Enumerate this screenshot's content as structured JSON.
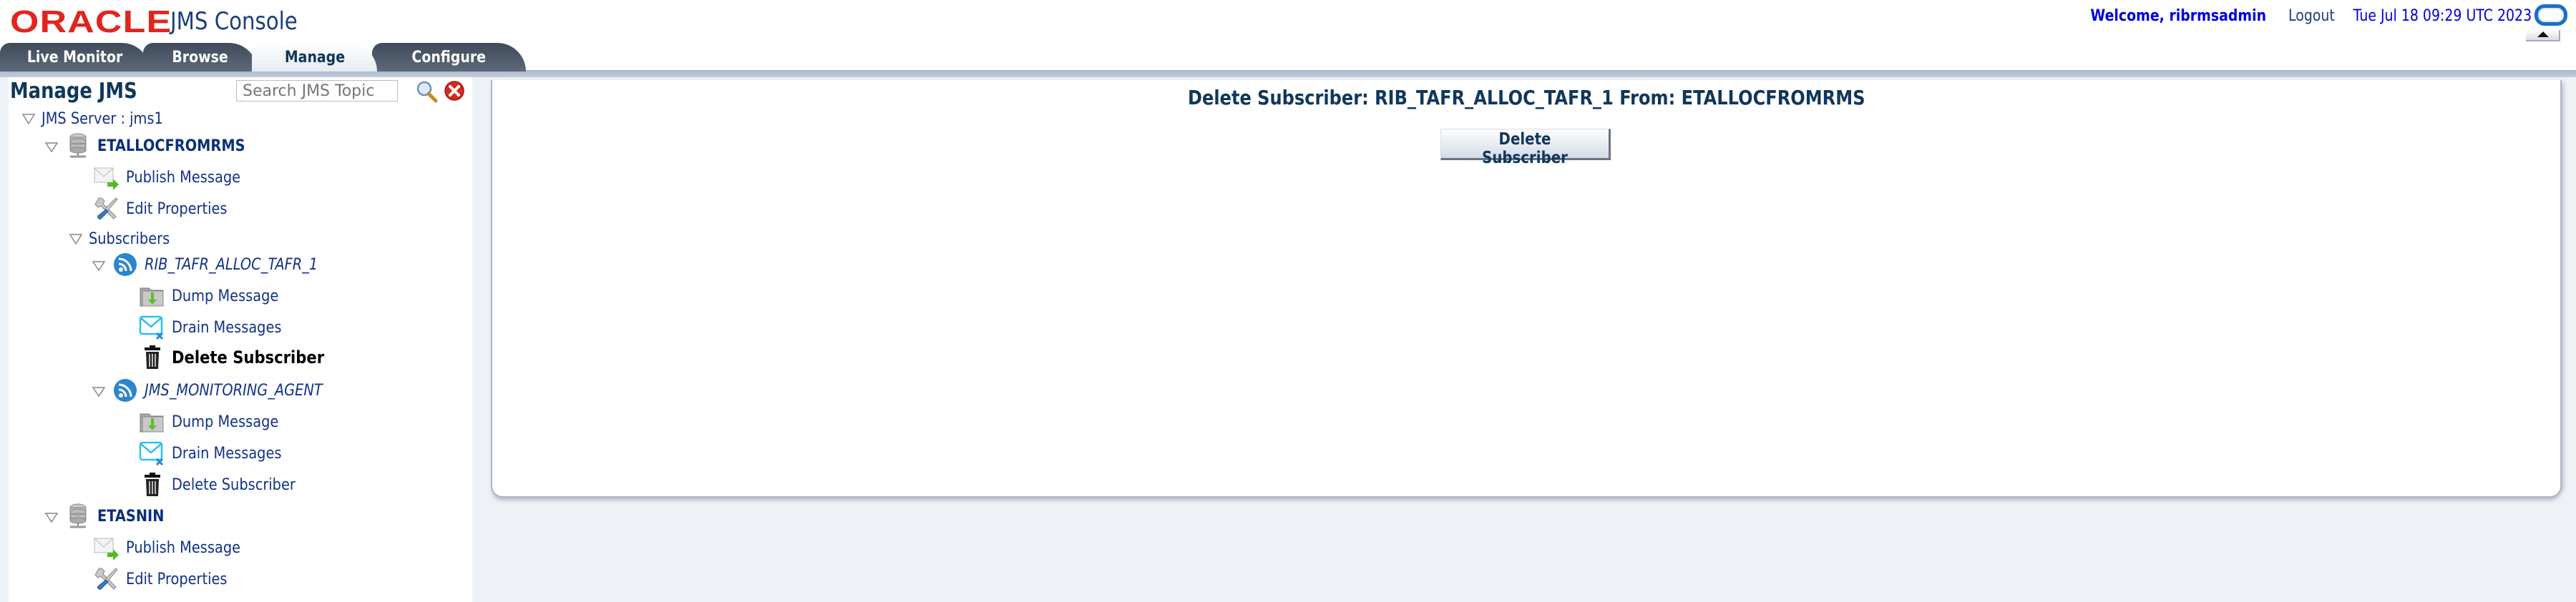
{
  "header": {
    "brand": "ORACLE",
    "brand_mark": "'",
    "app_title": "JMS Console",
    "welcome": "Welcome, ribrmsadmin",
    "logout": "Logout",
    "datetime": "Tue Jul 18 09:29 UTC 2023"
  },
  "tabs": [
    {
      "label": "Live Monitor",
      "active": false
    },
    {
      "label": "Browse",
      "active": false
    },
    {
      "label": "Manage",
      "active": true
    },
    {
      "label": "Configure",
      "active": false
    }
  ],
  "sidebar": {
    "title": "Manage JMS",
    "search_placeholder": "Search JMS Topic",
    "tree": {
      "server": "JMS Server : jms1",
      "topic1": {
        "name": "ETALLOCFROMRMS",
        "publish": "Publish Message",
        "edit": "Edit Properties",
        "subscribers_label": "Subscribers",
        "sub1": {
          "name": "RIB_TAFR_ALLOC_TAFR_1",
          "dump": "Dump Message",
          "drain": "Drain Messages",
          "delete": "Delete Subscriber"
        },
        "sub2": {
          "name": "JMS_MONITORING_AGENT",
          "dump": "Dump Message",
          "drain": "Drain Messages",
          "delete": "Delete Subscriber"
        }
      },
      "topic2": {
        "name": "ETASNIN",
        "publish": "Publish Message",
        "edit": "Edit Properties"
      }
    }
  },
  "main": {
    "heading": "Delete Subscriber: RIB_TAFR_ALLOC_TAFR_1 From: ETALLOCFROMRMS",
    "delete_button": "Delete Subscriber"
  },
  "colors": {
    "brand_red": "#e2251c",
    "title_navy": "#10375c",
    "link_blue": "#12318a",
    "welcome_blue": "#0000dd"
  }
}
